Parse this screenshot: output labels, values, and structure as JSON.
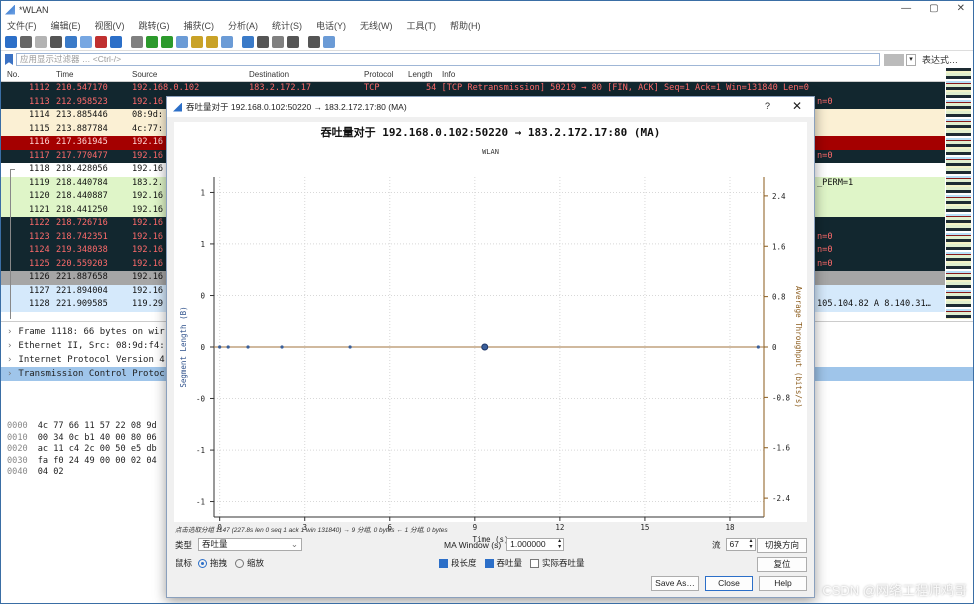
{
  "window": {
    "title": "*WLAN"
  },
  "menu": [
    "文件(F)",
    "编辑(E)",
    "视图(V)",
    "跳转(G)",
    "捕获(C)",
    "分析(A)",
    "统计(S)",
    "电话(Y)",
    "无线(W)",
    "工具(T)",
    "帮助(H)"
  ],
  "filter": {
    "placeholder": "应用显示过滤器 … <Ctrl-/>",
    "expression_label": "表达式…"
  },
  "columns": [
    "No.",
    "Time",
    "Source",
    "Destination",
    "Protocol",
    "Length",
    "Info"
  ],
  "packets": [
    {
      "no": "1112",
      "time": "210.547170",
      "src": "192.168.0.102",
      "dst": "183.2.172.17",
      "proto": "TCP",
      "info": "54 [TCP Retransmission] 50219 → 80 [FIN, ACK] Seq=1 Ack=1 Win=131840 Len=0",
      "bg": "#12272f",
      "fg": "#ff6b6b"
    },
    {
      "no": "1113",
      "time": "212.958523",
      "src": "192.16",
      "dst": "",
      "proto": "",
      "info": "n=0",
      "bg": "#12272f",
      "fg": "#ff6b6b"
    },
    {
      "no": "1114",
      "time": "213.885446",
      "src": "08:9d:",
      "dst": "",
      "proto": "",
      "info": "",
      "bg": "#fbf0d4",
      "fg": "#111"
    },
    {
      "no": "1115",
      "time": "213.887784",
      "src": "4c:77:",
      "dst": "",
      "proto": "",
      "info": "",
      "bg": "#fbf0d4",
      "fg": "#111"
    },
    {
      "no": "1116",
      "time": "217.361945",
      "src": "192.16",
      "dst": "",
      "proto": "",
      "info": "",
      "bg": "#a40000",
      "fg": "#ffd5d5"
    },
    {
      "no": "1117",
      "time": "217.770477",
      "src": "192.16",
      "dst": "",
      "proto": "",
      "info": "n=0",
      "bg": "#12272f",
      "fg": "#ff6b6b"
    },
    {
      "no": "1118",
      "time": "218.428056",
      "src": "192.16",
      "dst": "",
      "proto": "",
      "info": "",
      "bg": "#ffffff",
      "fg": "#111"
    },
    {
      "no": "1119",
      "time": "218.440784",
      "src": "183.2.",
      "dst": "",
      "proto": "",
      "info": "_PERM=1",
      "bg": "#dff5c8",
      "fg": "#111"
    },
    {
      "no": "1120",
      "time": "218.440887",
      "src": "192.16",
      "dst": "",
      "proto": "",
      "info": "",
      "bg": "#dff5c8",
      "fg": "#111"
    },
    {
      "no": "1121",
      "time": "218.441250",
      "src": "192.16",
      "dst": "",
      "proto": "",
      "info": "",
      "bg": "#dff5c8",
      "fg": "#111"
    },
    {
      "no": "1122",
      "time": "218.726716",
      "src": "192.16",
      "dst": "",
      "proto": "",
      "info": "",
      "bg": "#12272f",
      "fg": "#ff6b6b"
    },
    {
      "no": "1123",
      "time": "218.742351",
      "src": "192.16",
      "dst": "",
      "proto": "",
      "info": "n=0",
      "bg": "#12272f",
      "fg": "#ff6b6b"
    },
    {
      "no": "1124",
      "time": "219.348038",
      "src": "192.16",
      "dst": "",
      "proto": "",
      "info": "n=0",
      "bg": "#12272f",
      "fg": "#ff6b6b"
    },
    {
      "no": "1125",
      "time": "220.559203",
      "src": "192.16",
      "dst": "",
      "proto": "",
      "info": "n=0",
      "bg": "#12272f",
      "fg": "#ff6b6b"
    },
    {
      "no": "1126",
      "time": "221.887658",
      "src": "192.16",
      "dst": "",
      "proto": "",
      "info": "",
      "bg": "#a6a6a6",
      "fg": "#111"
    },
    {
      "no": "1127",
      "time": "221.894004",
      "src": "192.16",
      "dst": "",
      "proto": "",
      "info": "",
      "bg": "#d5e9fb",
      "fg": "#111"
    },
    {
      "no": "1128",
      "time": "221.909585",
      "src": "119.29",
      "dst": "",
      "proto": "",
      "info": "105.104.82 A 8.140.31…",
      "bg": "#d5e9fb",
      "fg": "#111"
    }
  ],
  "details": [
    "Frame 1118: 66 bytes on wir",
    "Ethernet II, Src: 08:9d:f4:",
    "Internet Protocol Version 4",
    "Transmission Control Protoc"
  ],
  "hex": [
    {
      "off": "0000",
      "bytes": "4c 77 66 11 57 22 08 9d"
    },
    {
      "off": "0010",
      "bytes": "00 34 0c b1 40 00 80 06"
    },
    {
      "off": "0020",
      "bytes": "ac 11 c4 2c 00 50 e5 db"
    },
    {
      "off": "0030",
      "bytes": "fa f0 24 49 00 00 02 04"
    },
    {
      "off": "0040",
      "bytes": "04 02"
    }
  ],
  "dialog": {
    "title": "吞吐量对于 192.168.0.102:50220 → 183.2.172.17:80 (MA)",
    "help": "?",
    "status": "点击选取分组 1147 (227.8s len 0 seq 1 ack 1 win 131840) → 9 分组, 0 bytes ← 1 分组, 0 bytes",
    "type_label": "类型",
    "type_value": "吞吐量",
    "mouse_label": "鼠标",
    "drag_label": "拖拽",
    "zoom_label": "缩放",
    "ma_label": "MA Window (s)",
    "ma_value": "1.000000",
    "stream_label": "流",
    "stream_value": "67",
    "switch_btn": "切换方向",
    "reset_btn": "复位",
    "seg_len_label": "段长度",
    "throughput_label": "吞吐量",
    "goodput_label": "实际吞吐量",
    "save_btn": "Save As…",
    "close_btn": "Close",
    "help_btn": "Help"
  },
  "chart_data": {
    "type": "scatter",
    "title": "吞吐量对于 192.168.0.102:50220 → 183.2.172.17:80 (MA)",
    "subtitle": "WLAN",
    "xlabel": "Time (s)",
    "ylabel": "Segment Length (B)",
    "y2label": "Average Throughput (bits/s)",
    "xlim": [
      -0.2,
      19.2
    ],
    "ylim": [
      -1.1,
      1.1
    ],
    "y2lim": [
      -2.7,
      2.7
    ],
    "xticks": [
      0,
      3,
      6,
      9,
      12,
      15,
      18
    ],
    "yticks": [
      -1,
      -1,
      0,
      0,
      1,
      1
    ],
    "y2ticks": [
      -2.4,
      -1.6,
      -0.8,
      0,
      0.8,
      1.6,
      2.4
    ],
    "points_x": [
      0,
      0.3,
      1.0,
      2.2,
      4.6,
      9.35,
      19.0
    ],
    "points_y": [
      0,
      0,
      0,
      0,
      0,
      0,
      0
    ],
    "highlight_x": 9.35,
    "throughput_line": 0,
    "grid": true,
    "colors": {
      "points": "#3a5f9a",
      "throughput": "#a0733c"
    }
  },
  "watermark": "CSDN @网络工程师鸡哥"
}
